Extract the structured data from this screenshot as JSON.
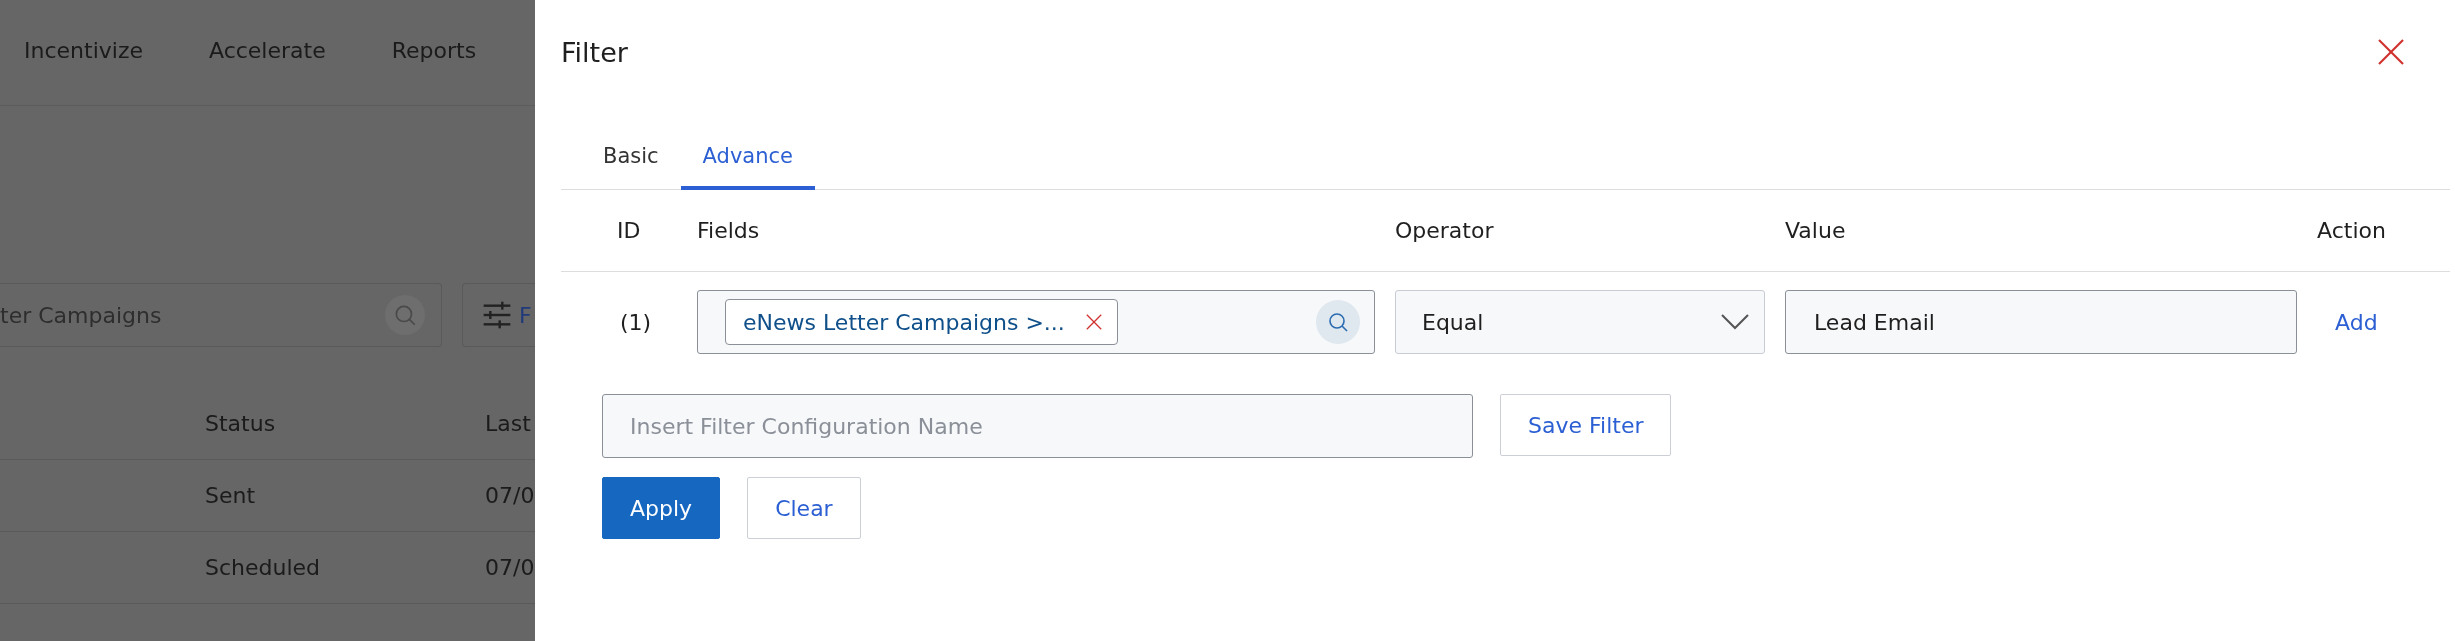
{
  "background": {
    "nav": [
      "Incentivize",
      "Accelerate",
      "Reports"
    ],
    "search": {
      "placeholder": "ter Campaigns"
    },
    "filter_button": {
      "label": "F"
    },
    "table": {
      "columns": [
        "Status",
        "Last"
      ],
      "rows": [
        [
          "Sent",
          "07/0"
        ],
        [
          "Scheduled",
          "07/0"
        ]
      ]
    }
  },
  "filter_panel": {
    "title": "Filter",
    "tabs": [
      {
        "label": "Basic",
        "selected": false
      },
      {
        "label": "Advance",
        "selected": true
      }
    ],
    "columns": [
      "ID",
      "Fields",
      "Operator",
      "Value",
      "Action"
    ],
    "rows": [
      {
        "id": "(1)",
        "field_chip": "eNews Letter Campaigns >...",
        "operator": "Equal",
        "value": "Lead Email",
        "action": "Add"
      }
    ],
    "config_name": {
      "placeholder": "Insert Filter Configuration Name"
    },
    "save_button": "Save Filter",
    "buttons": [
      {
        "label": "Apply",
        "kind": "primary"
      },
      {
        "label": "Clear",
        "kind": "secondary"
      }
    ]
  }
}
